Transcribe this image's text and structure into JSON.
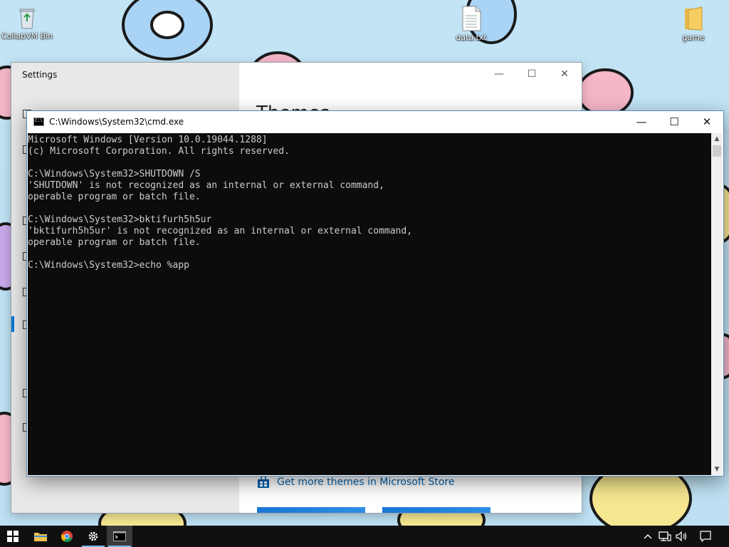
{
  "desktop": {
    "icons": [
      {
        "label": "CollabVM Bin",
        "icon": "recycle-bin-icon"
      },
      {
        "label": "data.txt",
        "icon": "text-file-icon"
      },
      {
        "label": "game",
        "icon": "folder-icon"
      }
    ]
  },
  "settings_window": {
    "title": "Settings",
    "heading": "Themes",
    "store_link": "Get more themes in Microsoft Store",
    "controls": {
      "minimize": "—",
      "maximize": "☐",
      "close": "✕"
    }
  },
  "cmd_window": {
    "title": "C:\\Windows\\System32\\cmd.exe",
    "controls": {
      "minimize": "—",
      "maximize": "☐",
      "close": "✕"
    },
    "lines": [
      "Microsoft Windows [Version 10.0.19044.1288]",
      "(c) Microsoft Corporation. All rights reserved.",
      "",
      "C:\\Windows\\System32>SHUTDOWN /S",
      "'SHUTDOWN' is not recognized as an internal or external command,",
      "operable program or batch file.",
      "",
      "C:\\Windows\\System32>bktifurh5h5ur",
      "'bktifurh5h5ur' is not recognized as an internal or external command,",
      "operable program or batch file.",
      "",
      "C:\\Windows\\System32>echo %app"
    ],
    "scroll": {
      "up": "▲",
      "down": "▼"
    }
  },
  "taskbar": {
    "items": [
      "start-button",
      "file-explorer",
      "chrome",
      "settings",
      "command-prompt"
    ],
    "tray": [
      "chevron-up-icon",
      "network-icon",
      "volume-icon",
      "notifications-icon"
    ]
  }
}
